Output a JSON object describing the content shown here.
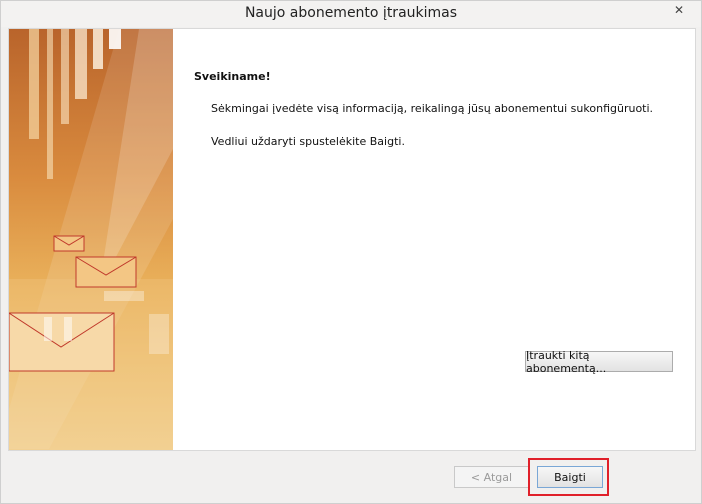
{
  "window": {
    "title": "Naujo abonemento įtraukimas",
    "close_icon": "close-icon"
  },
  "main": {
    "heading": "Sveikiname!",
    "message": "Sėkmingai įvedėte visą informaciją, reikalingą jūsų abonementui sukonfigūruoti.",
    "instruction": "Vedliui uždaryti spustelėkite Baigti.",
    "add_another_label": "Įtraukti kitą abonementą..."
  },
  "footer": {
    "back_label": "< Atgal",
    "finish_label": "Baigti"
  },
  "colors": {
    "highlight": "#e0202a",
    "side_art": "#d98b3e"
  }
}
